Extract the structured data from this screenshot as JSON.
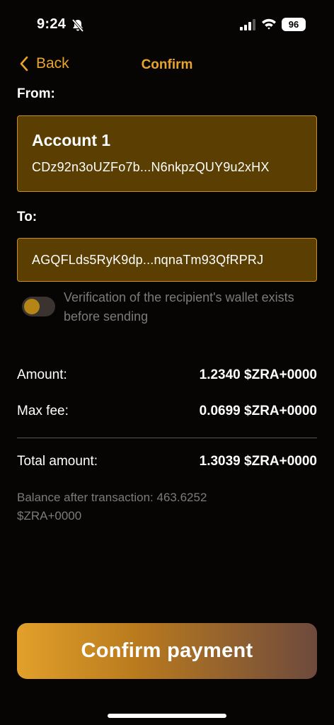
{
  "status_bar": {
    "time": "9:24",
    "battery": "96"
  },
  "header": {
    "back_label": "Back",
    "title": "Confirm"
  },
  "from": {
    "label": "From:",
    "account_name": "Account 1",
    "address": "CDz92n3oUZFo7b...N6nkpzQUY9u2xHX"
  },
  "to": {
    "label": "To:",
    "address": "AGQFLds5RyK9dp...nqnaTm93QfRPRJ"
  },
  "verification": {
    "text": "Verification of the recipient's wallet exists before sending",
    "enabled": false
  },
  "summary": {
    "amount_label": "Amount:",
    "amount_value": "1.2340 $ZRA+0000",
    "fee_label": "Max fee:",
    "fee_value": "0.0699 $ZRA+0000",
    "total_label": "Total amount:",
    "total_value": "1.3039 $ZRA+0000",
    "balance_after": "Balance after transaction: 463.6252 $ZRA+0000"
  },
  "confirm_button": {
    "label": "Confirm payment"
  },
  "colors": {
    "accent": "#E9A52A",
    "card_bg": "#5A3E02",
    "card_border": "#C98F1C",
    "background": "#070404"
  }
}
